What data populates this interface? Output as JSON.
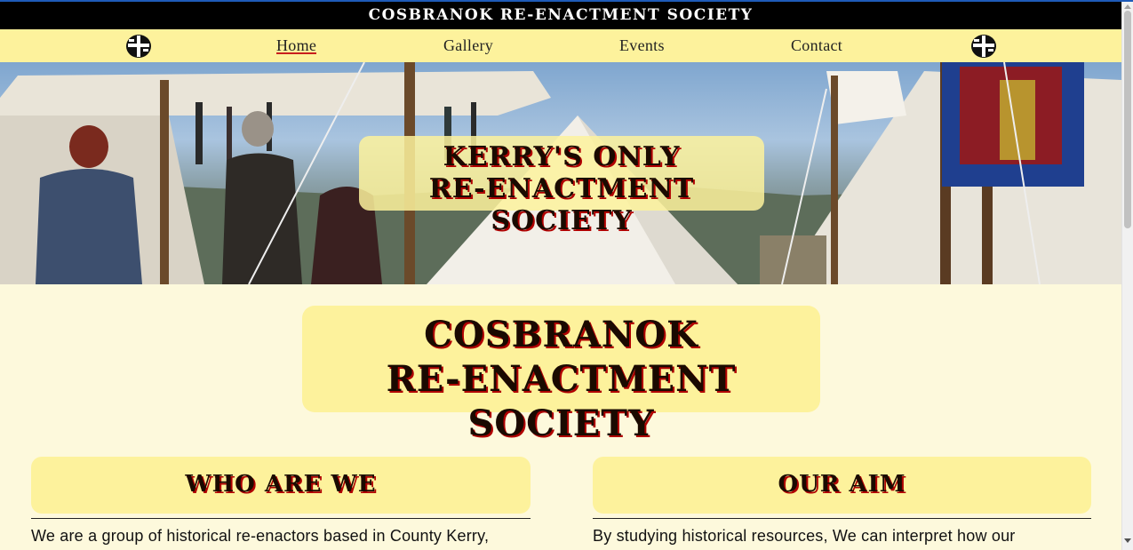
{
  "header": {
    "title": "COSBRANOK RE-ENACTMENT SOCIETY"
  },
  "nav": {
    "items": [
      {
        "label": "Home",
        "active": true
      },
      {
        "label": "Gallery",
        "active": false
      },
      {
        "label": "Events",
        "active": false
      },
      {
        "label": "Contact",
        "active": false
      }
    ],
    "logo_icon": "cross-shield-icon"
  },
  "hero": {
    "line1": "KERRY'S ONLY",
    "line2": "RE-ENACTMENT SOCIETY"
  },
  "main": {
    "title_line1": "COSBRANOK",
    "title_line2": "RE-ENACTMENT SOCIETY"
  },
  "sections": [
    {
      "heading": "WHO ARE WE",
      "text": "We are a group of historical re-enactors based in County Kerry,"
    },
    {
      "heading": "OUR AIM",
      "text": "By studying historical resources, We can interpret how our"
    }
  ],
  "colors": {
    "accent_yellow": "#fdf29c",
    "page_bg": "#fdf9dc",
    "shadow_red": "#b00000",
    "titlebar_bg": "#000000"
  }
}
